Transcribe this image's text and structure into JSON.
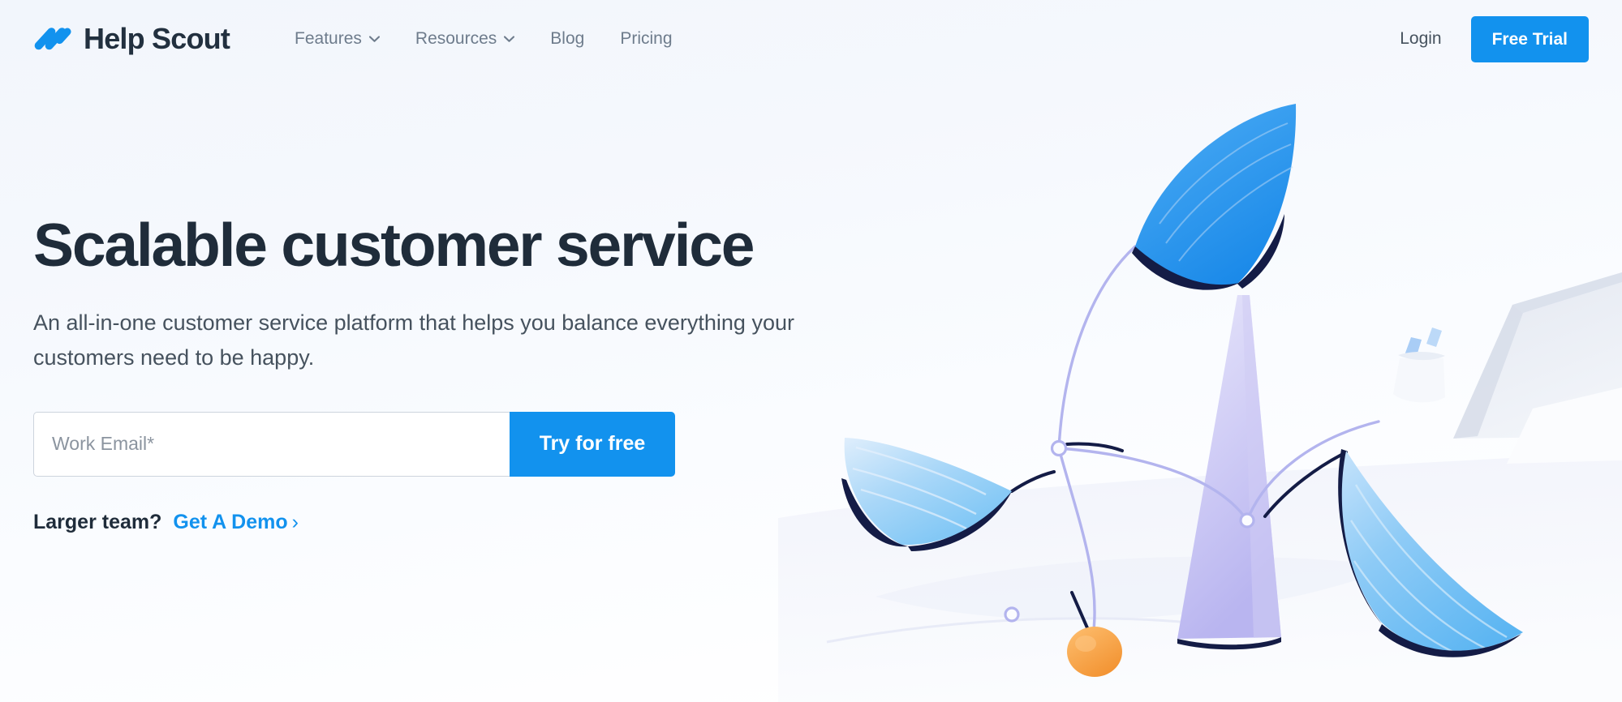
{
  "brand": {
    "name": "Help Scout",
    "logo_icon": "helpscout-slashes-logo",
    "logo_color": "#1292ee",
    "wordmark_color": "#22303f"
  },
  "header": {
    "nav": [
      {
        "label": "Features",
        "has_dropdown": true,
        "icon": "chevron-down-icon"
      },
      {
        "label": "Resources",
        "has_dropdown": true,
        "icon": "chevron-down-icon"
      },
      {
        "label": "Blog",
        "has_dropdown": false,
        "icon": ""
      },
      {
        "label": "Pricing",
        "has_dropdown": false,
        "icon": ""
      }
    ],
    "login_label": "Login",
    "free_trial_label": "Free Trial",
    "accent_color": "#1292ee"
  },
  "hero": {
    "headline": "Scalable customer service",
    "subhead": "An all-in-one customer service platform that helps you balance everything your customers need to be happy.",
    "form": {
      "email_placeholder": "Work Email*",
      "email_value": "",
      "submit_label": "Try for free"
    },
    "demo": {
      "label": "Larger team?",
      "link_label": "Get A Demo",
      "link_arrow": "›",
      "link_color": "#1292ee"
    },
    "headline_color": "#1f2c3a",
    "subhead_color": "#46525e"
  },
  "illustration": {
    "name": "kinetic-mobile-sculpture-illustration",
    "description": "Abstract balanced mobile with leaf-shaped blades on a conical stand, orange counterweight sphere, pale laptop and pencil cup in background",
    "colors": {
      "blade_top": "#2a96ee",
      "blade_left": "#9fd2f7",
      "blade_right": "#7cc4f5",
      "stand": "#c6c4f2",
      "counterweight": "#f6a34a",
      "outline": "#141c46",
      "wire": "#b3b4ee",
      "background_object": "#e6eaf2"
    }
  },
  "background": {
    "gradient_start": "#f2f6fc",
    "gradient_end": "#ffffff"
  }
}
